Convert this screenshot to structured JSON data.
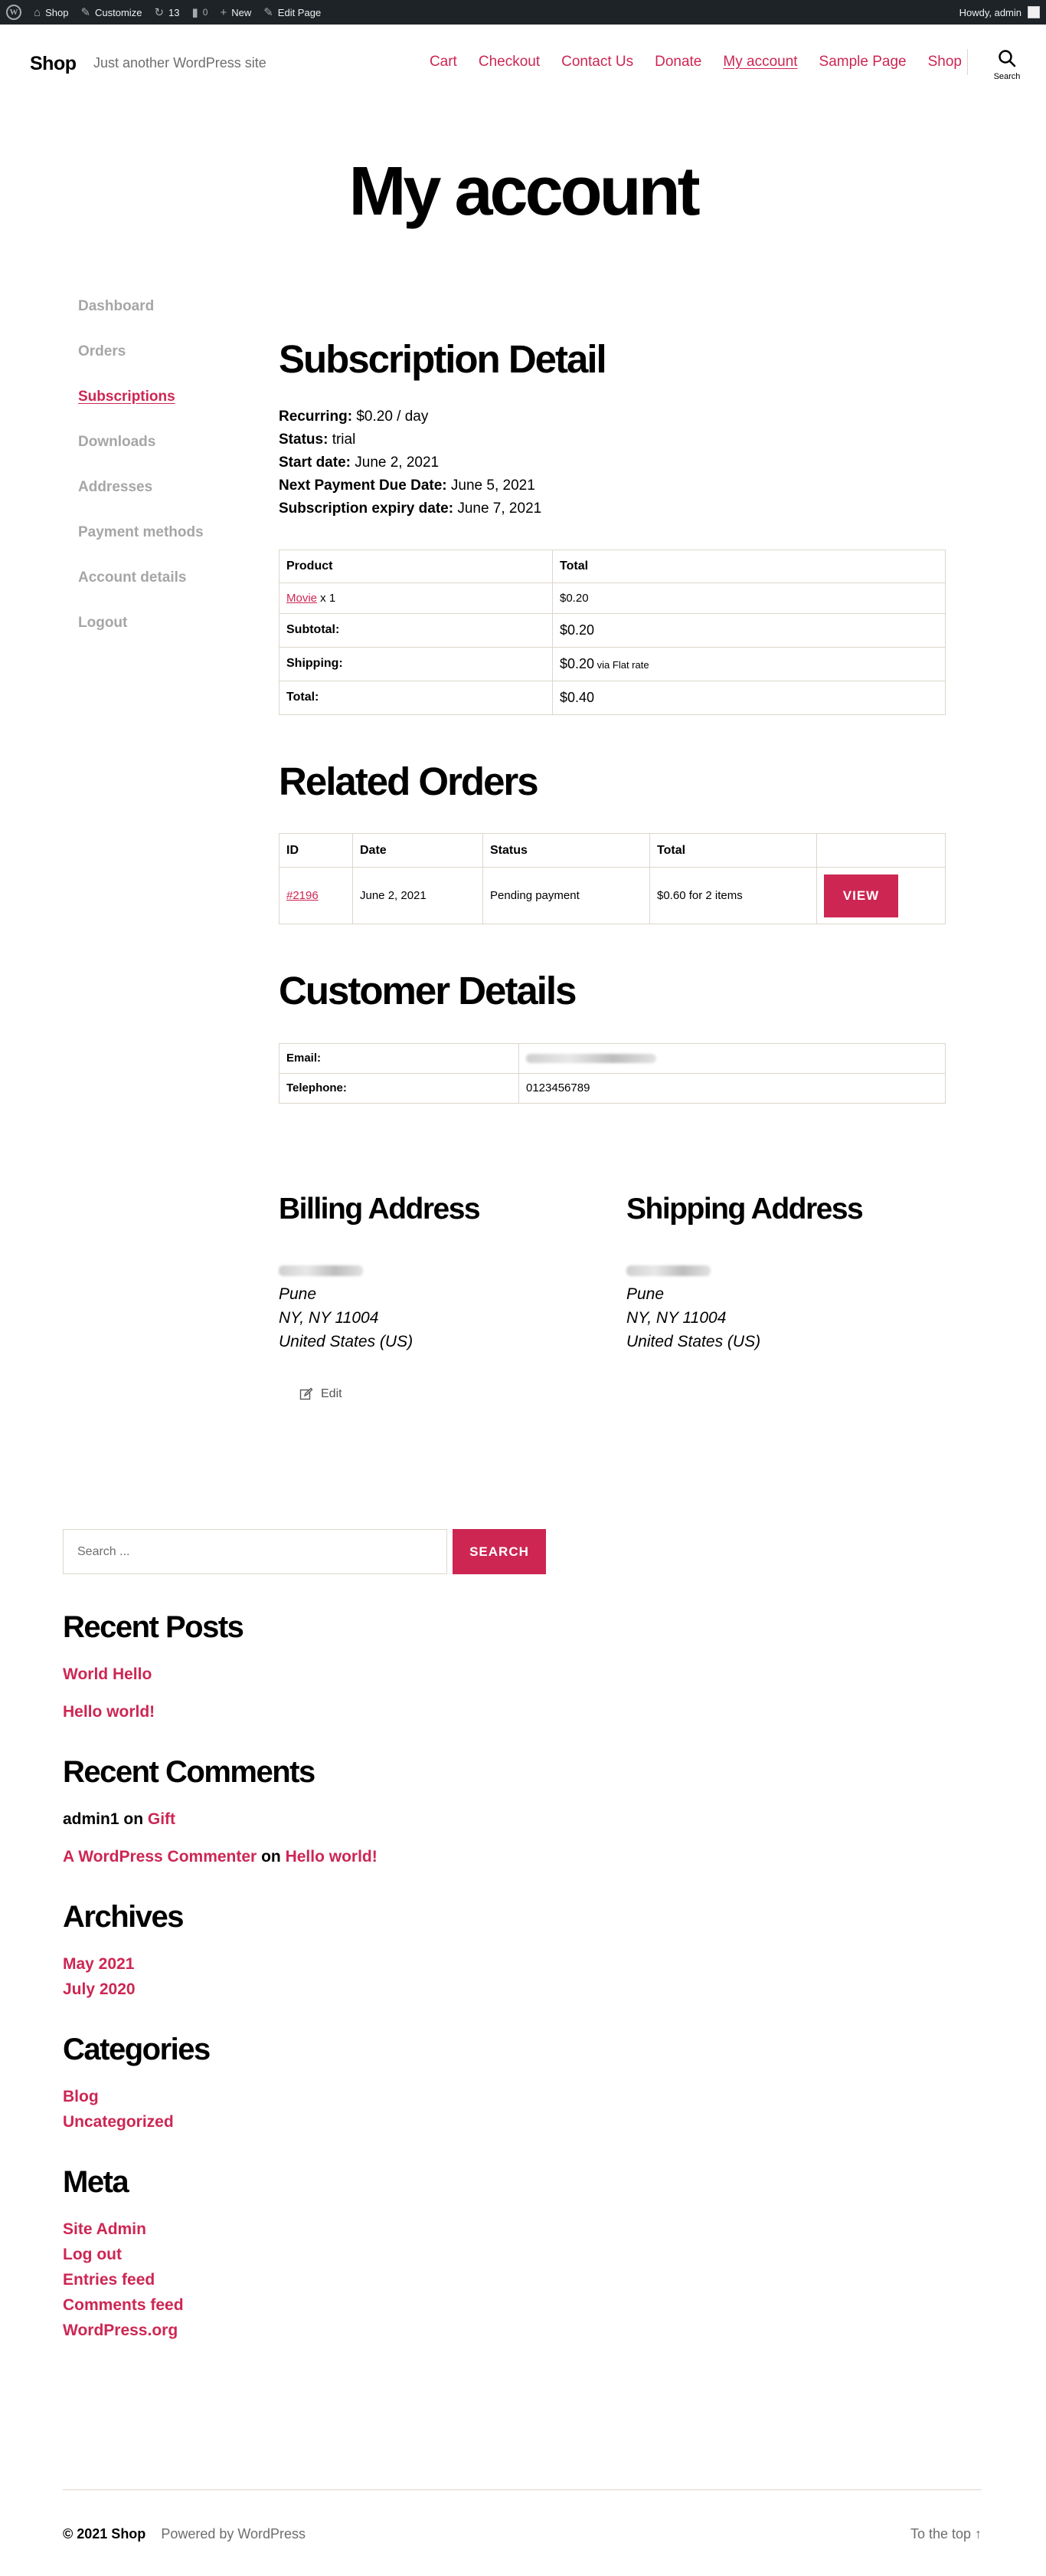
{
  "adminbar": {
    "site": "Shop",
    "customize": "Customize",
    "updates": "13",
    "comments": "0",
    "new": "New",
    "edit_page": "Edit Page",
    "howdy": "Howdy, admin"
  },
  "header": {
    "site_title": "Shop",
    "tagline": "Just another WordPress site",
    "nav": [
      "Cart",
      "Checkout",
      "Contact Us",
      "Donate",
      "My account",
      "Sample Page",
      "Shop"
    ],
    "current_nav": "My account",
    "search_label": "Search"
  },
  "page_title": "My account",
  "account_nav": [
    "Dashboard",
    "Orders",
    "Subscriptions",
    "Downloads",
    "Addresses",
    "Payment methods",
    "Account details",
    "Logout"
  ],
  "account_nav_active": "Subscriptions",
  "subscription": {
    "heading": "Subscription Detail",
    "fields": [
      {
        "label": "Recurring:",
        "value": "$0.20 / day"
      },
      {
        "label": "Status:",
        "value": "trial"
      },
      {
        "label": "Start date:",
        "value": "June 2, 2021"
      },
      {
        "label": "Next Payment Due Date:",
        "value": "June 5, 2021"
      },
      {
        "label": "Subscription expiry date:",
        "value": "June 7, 2021"
      }
    ],
    "table": {
      "headers": [
        "Product",
        "Total"
      ],
      "product_link": "Movie",
      "product_qty": " x 1",
      "product_total": "$0.20",
      "subtotal_label": "Subtotal:",
      "subtotal": "$0.20",
      "shipping_label": "Shipping:",
      "shipping": "$0.20",
      "shipping_note": " via Flat rate",
      "total_label": "Total:",
      "total": "$0.40"
    }
  },
  "related_orders": {
    "heading": "Related Orders",
    "headers": [
      "ID",
      "Date",
      "Status",
      "Total",
      ""
    ],
    "row": {
      "id": "#2196",
      "date": "June 2, 2021",
      "status": "Pending payment",
      "total": "$0.60 for 2 items",
      "action": "VIEW"
    }
  },
  "customer": {
    "heading": "Customer Details",
    "email_label": "Email:",
    "telephone_label": "Telephone:",
    "telephone": "0123456789"
  },
  "billing": {
    "heading": "Billing Address",
    "city": "Pune",
    "state_line": "NY, NY 11004",
    "country": "United States (US)"
  },
  "shipping": {
    "heading": "Shipping Address",
    "city": "Pune",
    "state_line": "NY, NY 11004",
    "country": "United States (US)"
  },
  "edit_label": "Edit",
  "widgets": {
    "search_placeholder": "Search ...",
    "search_button": "SEARCH",
    "recent_posts": {
      "title": "Recent Posts",
      "items": [
        "World Hello",
        "Hello world!"
      ]
    },
    "recent_comments": {
      "title": "Recent Comments",
      "items": [
        {
          "author": "admin1",
          "on": " on ",
          "post": "Gift"
        },
        {
          "author": "A WordPress Commenter",
          "on": " on ",
          "post": "Hello world!"
        }
      ]
    },
    "archives": {
      "title": "Archives",
      "items": [
        "May 2021",
        "July 2020"
      ]
    },
    "categories": {
      "title": "Categories",
      "items": [
        "Blog",
        "Uncategorized"
      ]
    },
    "meta": {
      "title": "Meta",
      "items": [
        "Site Admin",
        "Log out",
        "Entries feed",
        "Comments feed",
        "WordPress.org"
      ]
    }
  },
  "footer": {
    "copyright": "© 2021 Shop",
    "powered": "Powered by WordPress",
    "to_top": "To the top ↑"
  },
  "colors": {
    "accent": "#cd2653",
    "adminbar": "#1d2327",
    "muted": "#a6a6a6",
    "border": "#dcd7ca"
  }
}
